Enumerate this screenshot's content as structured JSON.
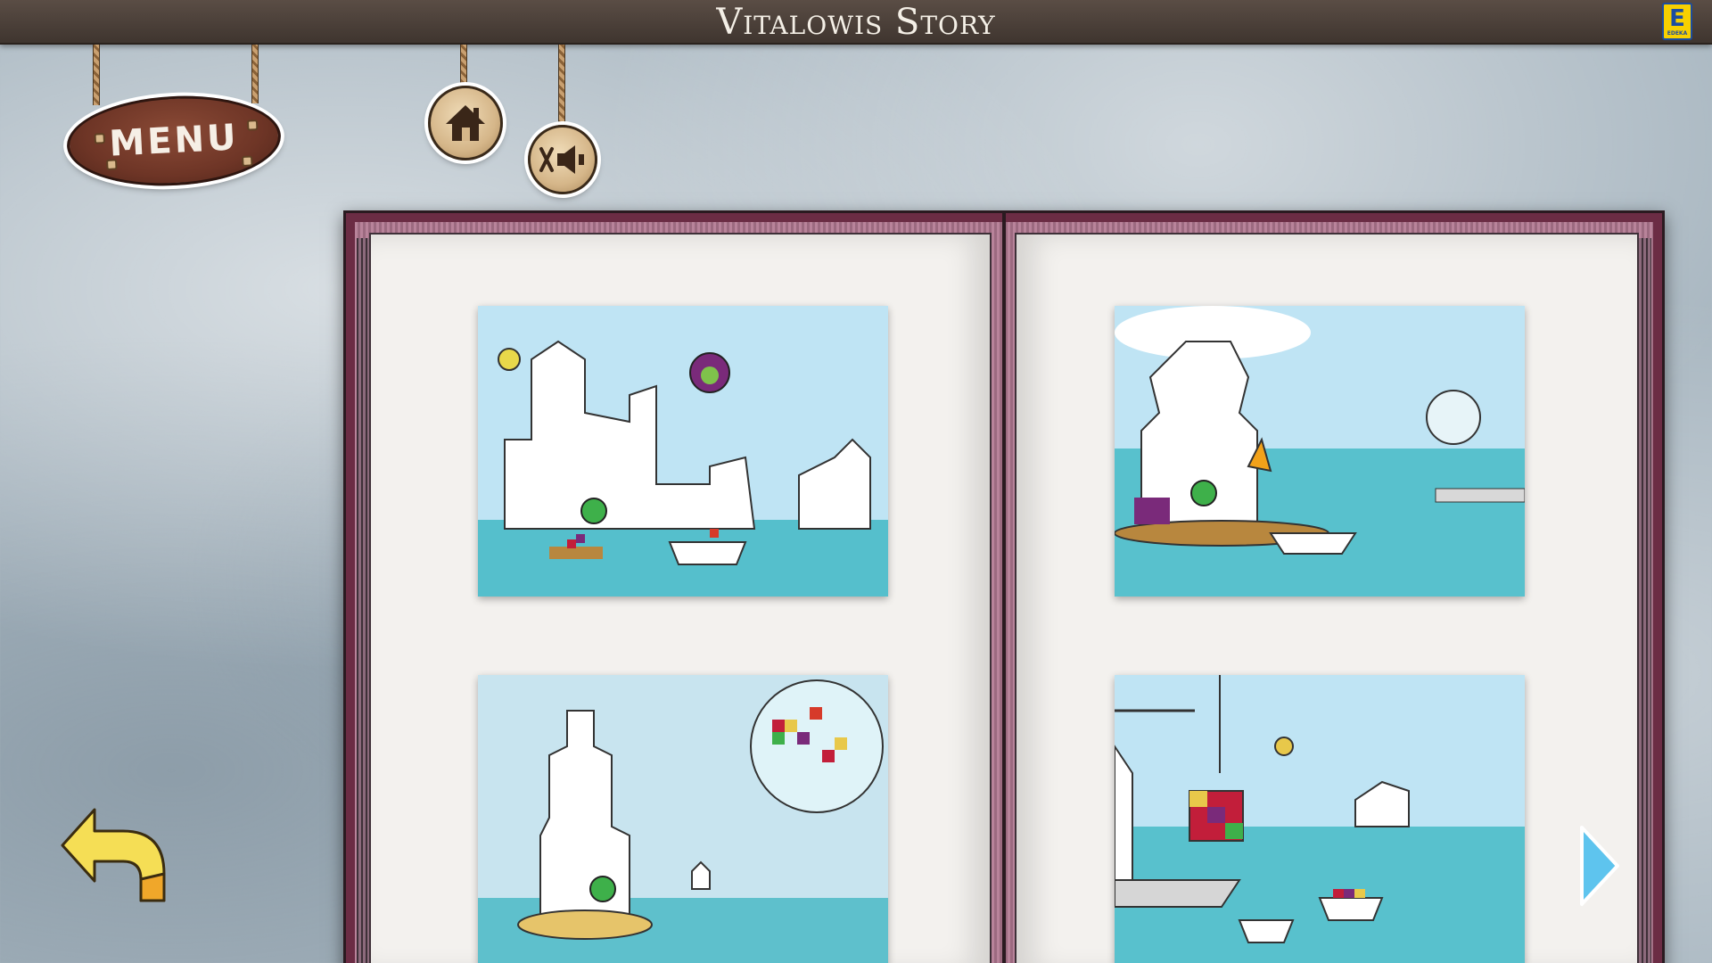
{
  "app": {
    "title": "Vitalowis Story",
    "brand_logo_letter": "E",
    "brand_logo_text": "EDEKA",
    "brand_color": "#f7d000"
  },
  "nav": {
    "menu_label": "MENU",
    "home_icon": "house-icon",
    "sound_icon": "speaker-muted-icon",
    "back_icon": "curved-back-arrow-icon",
    "next_icon": "triangle-right-arrow-icon"
  },
  "book": {
    "pages": [
      {
        "side": "left",
        "scenes": [
          "story-scene-1",
          "story-scene-3"
        ]
      },
      {
        "side": "right",
        "scenes": [
          "story-scene-2",
          "story-scene-4"
        ]
      }
    ]
  },
  "colors": {
    "titlebar": "#4a3e37",
    "book_cover": "#6b2c44",
    "page": "#f3f1ee",
    "sky": "#b3dff2",
    "sea": "#4cb6c6",
    "arrow_yellow": "#f5de55",
    "arrow_blue": "#5ec4ee"
  }
}
